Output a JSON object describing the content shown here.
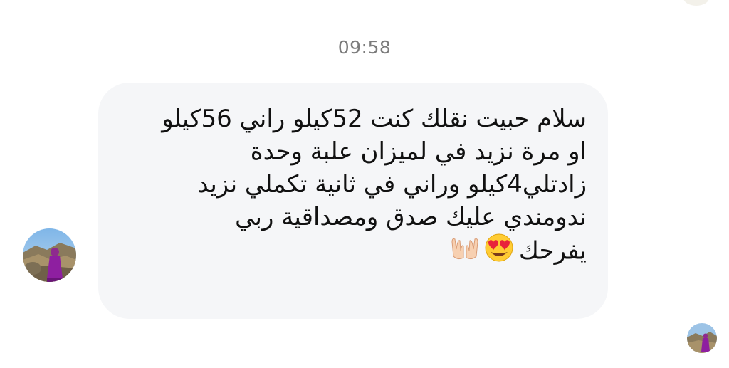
{
  "chat": {
    "timestamp": "09:58",
    "message": {
      "text": "سلام حبيت نقلك كنت 52كيلو راني 56كيلو\nاو مرة نزيد في لميزان علبة وحدة\nزادتلي4كيلو وراني في ثانية تكملي نزيد\nندومندي عليك صدق ومصداقية ربي\nيفرحك",
      "emojis": [
        "heart-eyes-emoji",
        "open-hands-emoji"
      ]
    }
  },
  "colors": {
    "bubble_bg": "#f5f6f8",
    "timestamp": "#7b7b7b",
    "text": "#111111"
  }
}
